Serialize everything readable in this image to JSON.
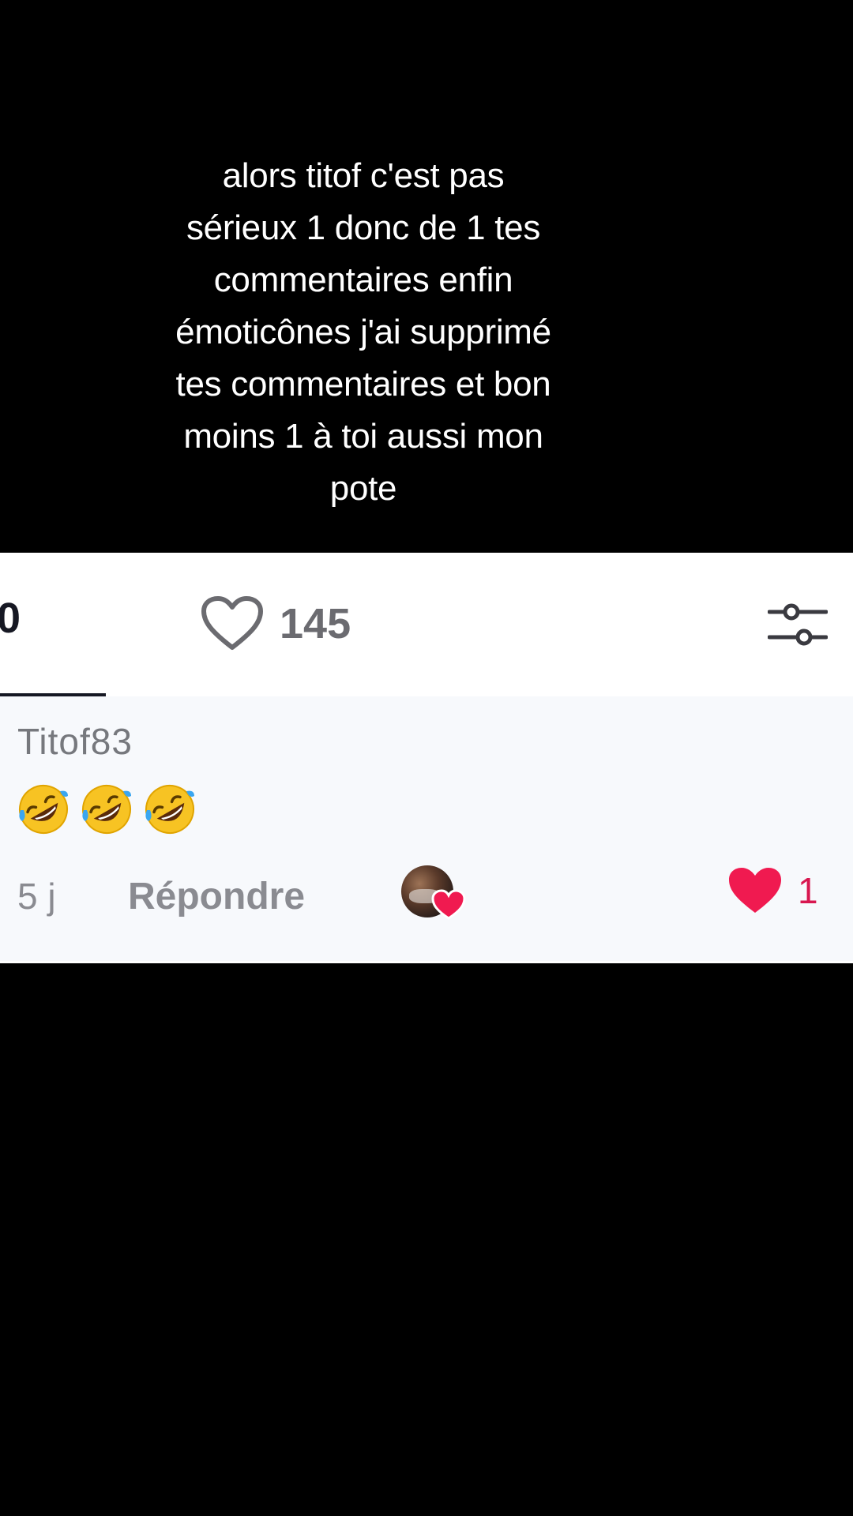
{
  "caption": {
    "lines": [
      "alors titof c'est pas",
      "sérieux 1 donc de 1 tes",
      "commentaires enfin",
      "émoticônes j'ai supprimé",
      "tes commentaires et bon",
      "moins 1 à toi aussi mon",
      "pote"
    ]
  },
  "tabs": {
    "left_count": "0",
    "likes_count": "145",
    "likes_icon": "heart-outline-icon",
    "filter_icon": "sliders-icon"
  },
  "comment": {
    "username": "Titof83",
    "emojis": [
      "rolling-on-floor-laughing-emoji",
      "rolling-on-floor-laughing-emoji",
      "rolling-on-floor-laughing-emoji"
    ],
    "time": "5 j",
    "reply_label": "Répondre",
    "like_count": "1"
  },
  "colors": {
    "background": "#000000",
    "card": "#ffffff",
    "comment_bg": "#f7f9fc",
    "heart_red": "#f01a50",
    "text_gray": "#8a8b91"
  }
}
